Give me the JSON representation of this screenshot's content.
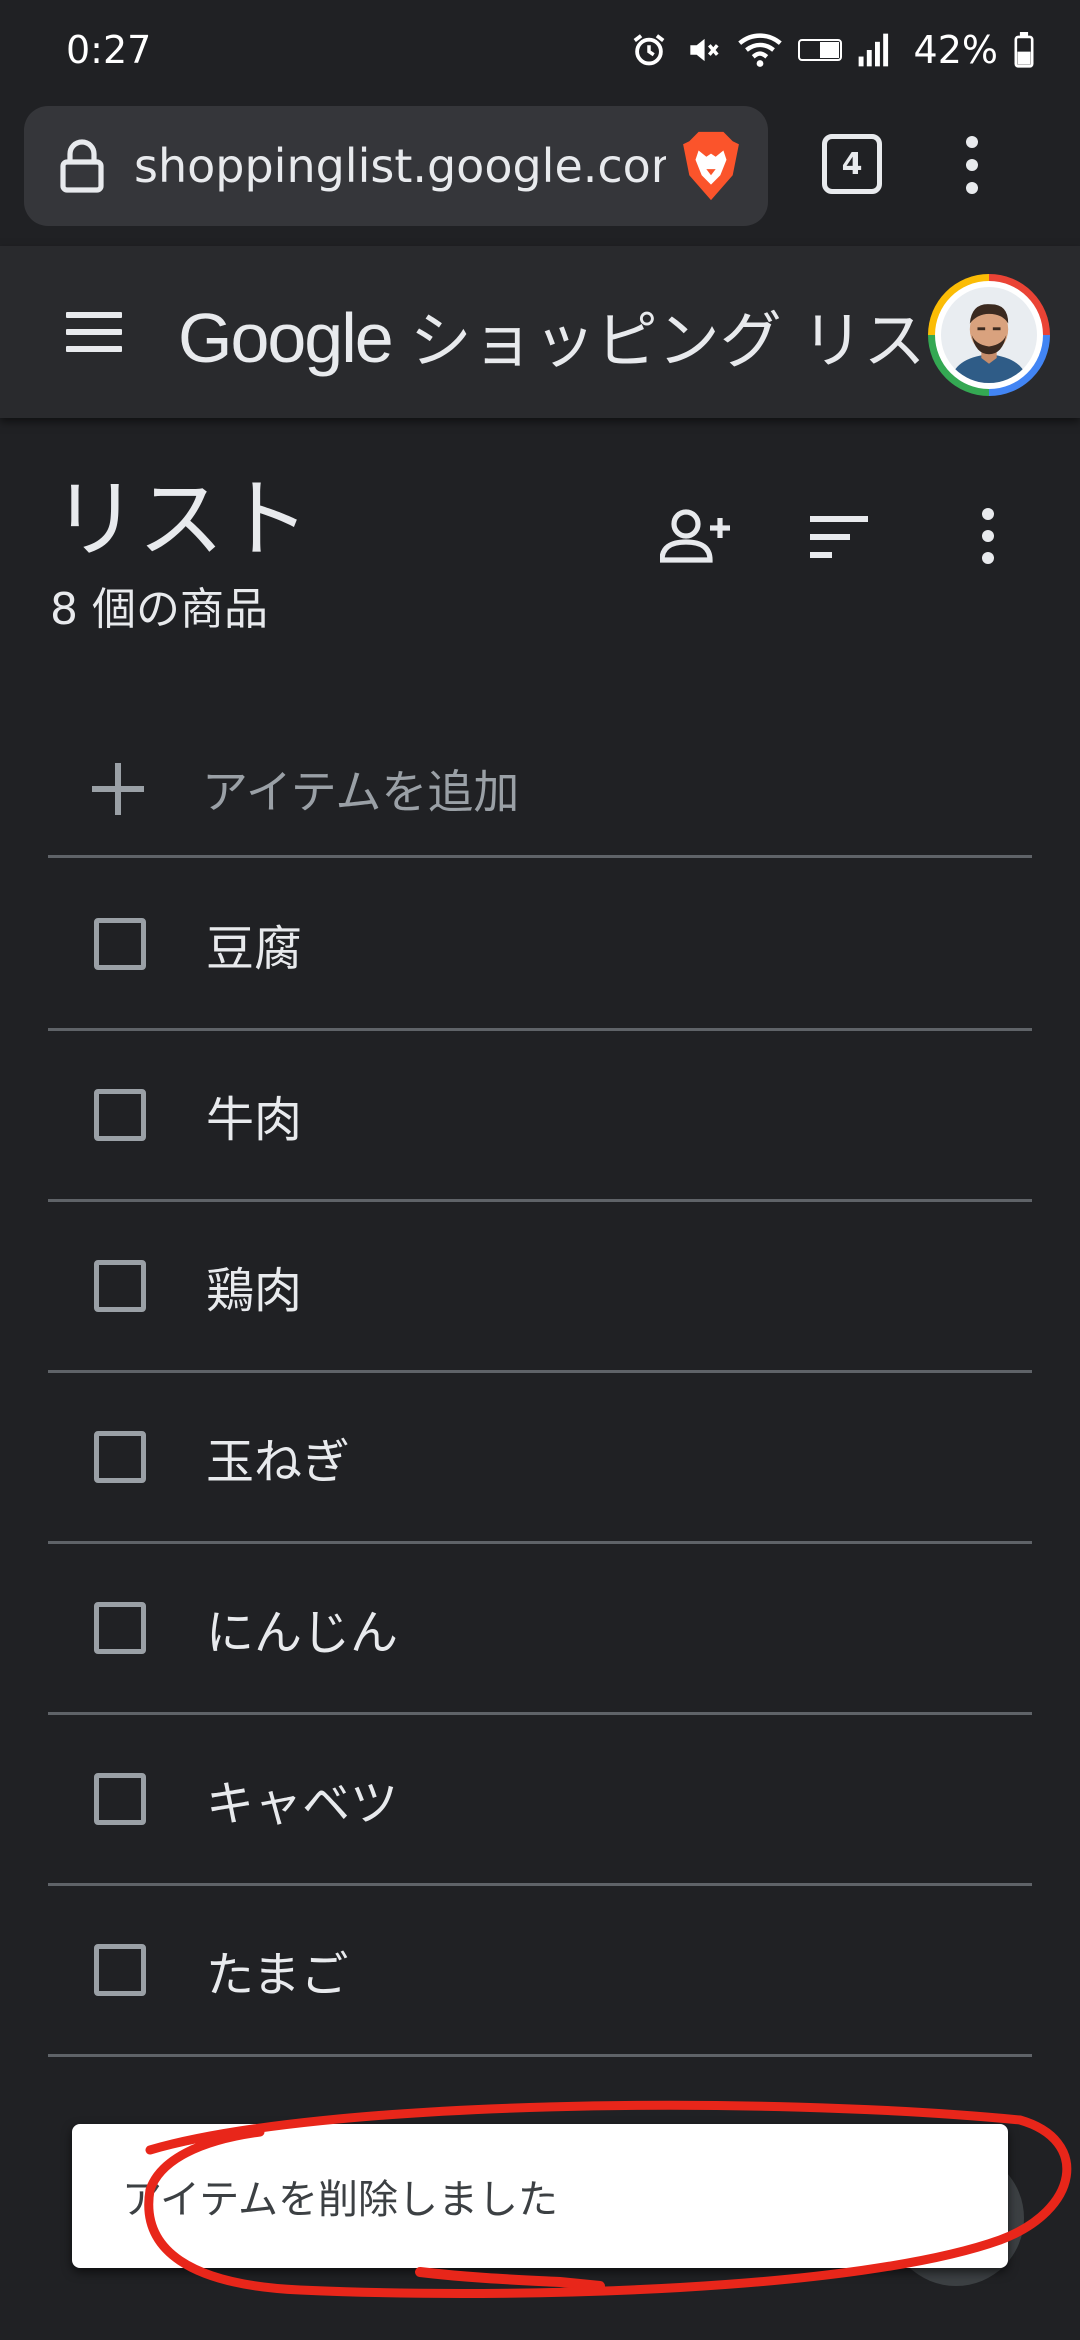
{
  "status_bar": {
    "time": "0:27",
    "battery": "42%",
    "icons": [
      "alarm-icon",
      "mute-icon",
      "wifi-icon",
      "volte-icon",
      "signal-icon",
      "battery-icon"
    ]
  },
  "browser": {
    "url": "shoppinglist.google.com",
    "tab_count": "4",
    "icons": [
      "lock-icon",
      "brave-lion-icon",
      "more-vert-icon"
    ]
  },
  "header": {
    "brand": "Google",
    "product": "ショッピング リスト",
    "icons": [
      "hamburger-icon",
      "avatar"
    ]
  },
  "list": {
    "title": "リスト",
    "count": "8 個の商品",
    "actions": [
      "person-add-icon",
      "sort-icon",
      "more-vert-icon"
    ],
    "add_item_label": "アイテムを追加",
    "items": [
      {
        "label": "豆腐",
        "checked": false
      },
      {
        "label": "牛肉",
        "checked": false
      },
      {
        "label": "鶏肉",
        "checked": false
      },
      {
        "label": "玉ねぎ",
        "checked": false
      },
      {
        "label": "にんじん",
        "checked": false
      },
      {
        "label": "キャベツ",
        "checked": false
      },
      {
        "label": "たまご",
        "checked": false
      }
    ]
  },
  "snackbar": {
    "message": "アイテムを削除しました"
  },
  "colors": {
    "background": "#202124",
    "header": "#292a2d",
    "url_box": "#35363a",
    "divider": "#5f6368",
    "annotation": "#e8261a"
  }
}
